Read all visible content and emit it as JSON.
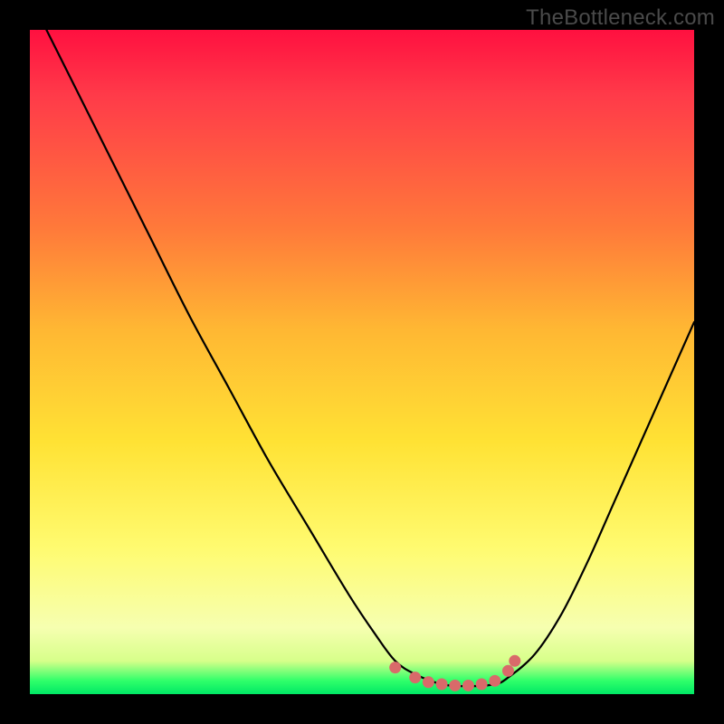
{
  "watermark": "TheBottleneck.com",
  "chart_data": {
    "type": "line",
    "title": "",
    "xlabel": "",
    "ylabel": "",
    "xlim": [
      0,
      100
    ],
    "ylim": [
      0,
      100
    ],
    "series": [
      {
        "name": "curve",
        "x": [
          0,
          6,
          12,
          18,
          24,
          30,
          36,
          42,
          48,
          52,
          55,
          58,
          62,
          66,
          70,
          72,
          76,
          80,
          84,
          88,
          92,
          96,
          100
        ],
        "y": [
          105,
          93,
          81,
          69,
          57,
          46,
          35,
          25,
          15,
          9,
          5,
          3,
          1.5,
          1.2,
          1.5,
          2.5,
          6,
          12,
          20,
          29,
          38,
          47,
          56
        ]
      }
    ],
    "dots": {
      "name": "flat-markers",
      "color": "#d96a6a",
      "points": [
        {
          "x": 55,
          "y": 4.0
        },
        {
          "x": 58,
          "y": 2.5
        },
        {
          "x": 60,
          "y": 1.8
        },
        {
          "x": 62,
          "y": 1.5
        },
        {
          "x": 64,
          "y": 1.3
        },
        {
          "x": 66,
          "y": 1.3
        },
        {
          "x": 68,
          "y": 1.5
        },
        {
          "x": 70,
          "y": 2.0
        },
        {
          "x": 72,
          "y": 3.5
        },
        {
          "x": 73,
          "y": 5.0
        }
      ]
    },
    "gradient_stops": [
      {
        "pos": 0,
        "color": "#ff1040"
      },
      {
        "pos": 30,
        "color": "#ff7a3a"
      },
      {
        "pos": 62,
        "color": "#ffe234"
      },
      {
        "pos": 90,
        "color": "#f6ffb0"
      },
      {
        "pos": 98,
        "color": "#2fff6a"
      },
      {
        "pos": 100,
        "color": "#00e865"
      }
    ]
  }
}
